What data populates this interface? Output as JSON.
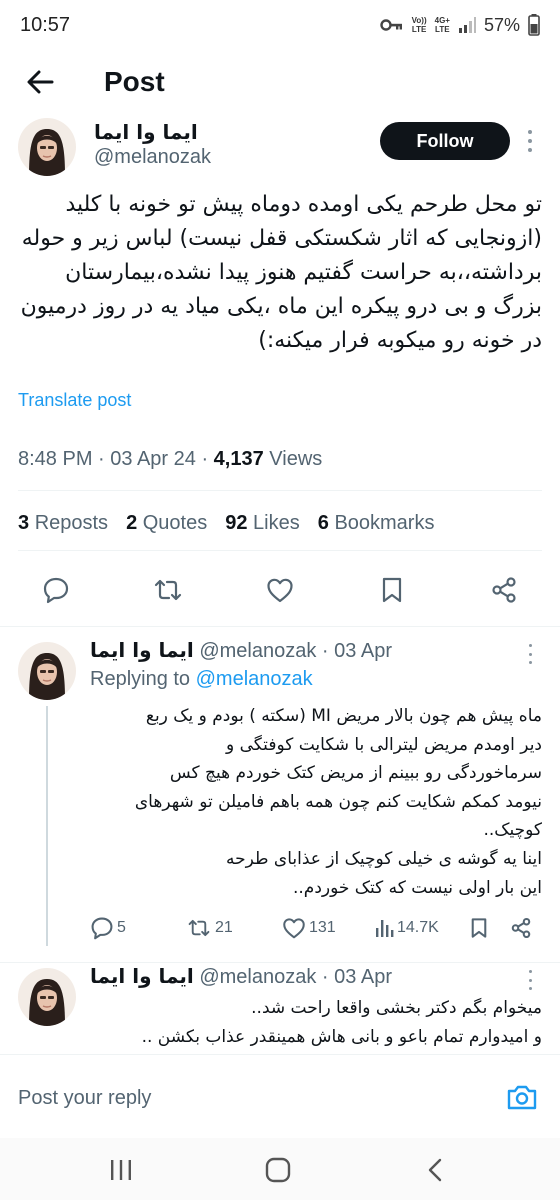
{
  "status_bar": {
    "time": "10:57",
    "network_top": "Vo))",
    "network_bottom": "LTE",
    "data_top": "4G+",
    "data_bottom": "LTE",
    "battery": "57%"
  },
  "header": {
    "title": "Post"
  },
  "post": {
    "author_name": "ایما وا ایما",
    "handle": "@melanozak",
    "follow_label": "Follow",
    "text": "تو محل طرحم یکی اومده دوماه پیش تو خونه با کلید (ازونجایی که اثار شکستکی قفل نیست) لباس زیر و حوله برداشته،،به حراست گفتیم هنوز پیدا نشده،بیمارستان بزرگ و بی درو پیکره این ماه ،یکی میاد یه در روز درمیون در خونه رو میکوبه فرار میکنه:)",
    "translate": "Translate post",
    "time": "8:48 PM",
    "date": "03 Apr 24",
    "views_count": "4,137",
    "views_label": "Views",
    "stats": {
      "reposts_count": "3",
      "reposts_label": "Reposts",
      "quotes_count": "2",
      "quotes_label": "Quotes",
      "likes_count": "92",
      "likes_label": "Likes",
      "bookmarks_count": "6",
      "bookmarks_label": "Bookmarks"
    }
  },
  "replies": [
    {
      "author_name": "ایما وا ایما",
      "handle": "@melanozak",
      "date": "03 Apr",
      "replying_label": "Replying to",
      "replying_handle": "@melanozak",
      "lines": [
        "ماه پیش هم چون بالار مریض MI (سکته ) بودم و یک ربع",
        "دیر اومدم مریض لیترالی با شکایت کوفتگی و",
        "سرماخوردگی رو ببینم از مریض کتک خوردم هیچ کس",
        "نیومد کمکم شکایت کنم چون همه باهم فامیلن تو شهرهای",
        "کوچیک..",
        "اینا یه گوشه ی خیلی کوچیک از عذابای طرحه",
        "این بار اولی نیست که کتک خوردم.."
      ],
      "replies_count": "5",
      "reposts_count": "21",
      "likes_count": "131",
      "views_count": "14.7K"
    },
    {
      "author_name": "ایما وا ایما",
      "handle": "@melanozak",
      "date": "03 Apr",
      "lines": [
        "میخوام بگم دکتر بخشی واقعا راحت شد..",
        "و امیدوارم تمام باعو و بانی هاش همینقدر عذاب بکشن .."
      ]
    }
  ],
  "reply_bar": {
    "placeholder": "Post your reply"
  },
  "colors": {
    "accent": "#1d9bf0",
    "text": "#0f1419",
    "secondary": "#536471",
    "follow_bg": "#0f1419"
  },
  "icons": [
    "back-arrow-icon",
    "key-icon",
    "wifi-icon",
    "signal-icon",
    "battery-icon",
    "reply-icon",
    "repost-icon",
    "like-icon",
    "bookmark-icon",
    "share-icon",
    "views-icon",
    "camera-icon",
    "recents-icon",
    "home-icon",
    "back-icon"
  ]
}
